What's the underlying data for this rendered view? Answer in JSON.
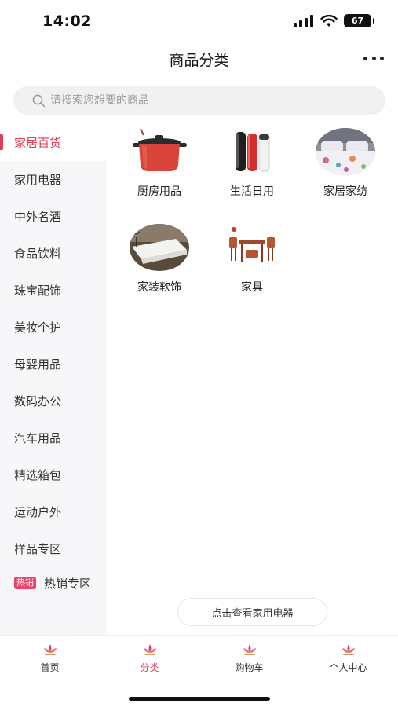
{
  "status_bar": {
    "time": "14:02",
    "battery": "67"
  },
  "header": {
    "title": "商品分类"
  },
  "search": {
    "placeholder": "请搜索您想要的商品"
  },
  "sidebar": {
    "items": [
      {
        "label": "家居百货"
      },
      {
        "label": "家用电器"
      },
      {
        "label": "中外名酒"
      },
      {
        "label": "食品饮料"
      },
      {
        "label": "珠宝配饰"
      },
      {
        "label": "美妆个护"
      },
      {
        "label": "母婴用品"
      },
      {
        "label": "数码办公"
      },
      {
        "label": "汽车用品"
      },
      {
        "label": "精选箱包"
      },
      {
        "label": "运动户外"
      },
      {
        "label": "样品专区"
      }
    ],
    "hot": {
      "badge": "热销",
      "label": "热销专区"
    }
  },
  "categories": [
    {
      "label": "厨房用品",
      "icon": "pot-icon"
    },
    {
      "label": "生活日用",
      "icon": "thermos-icon"
    },
    {
      "label": "家居家纺",
      "icon": "bedding-icon"
    },
    {
      "label": "家装软饰",
      "icon": "bed-frame-icon"
    },
    {
      "label": "家具",
      "icon": "furniture-icon"
    }
  ],
  "view_all": {
    "label": "点击查看家用电器"
  },
  "tabbar": {
    "tabs": [
      {
        "label": "首页"
      },
      {
        "label": "分类"
      },
      {
        "label": "购物车"
      },
      {
        "label": "个人中心"
      }
    ]
  },
  "colors": {
    "accent": "#e23b55",
    "sidebar_bg": "#f7f7f9",
    "search_bg": "#f1f1f1"
  }
}
